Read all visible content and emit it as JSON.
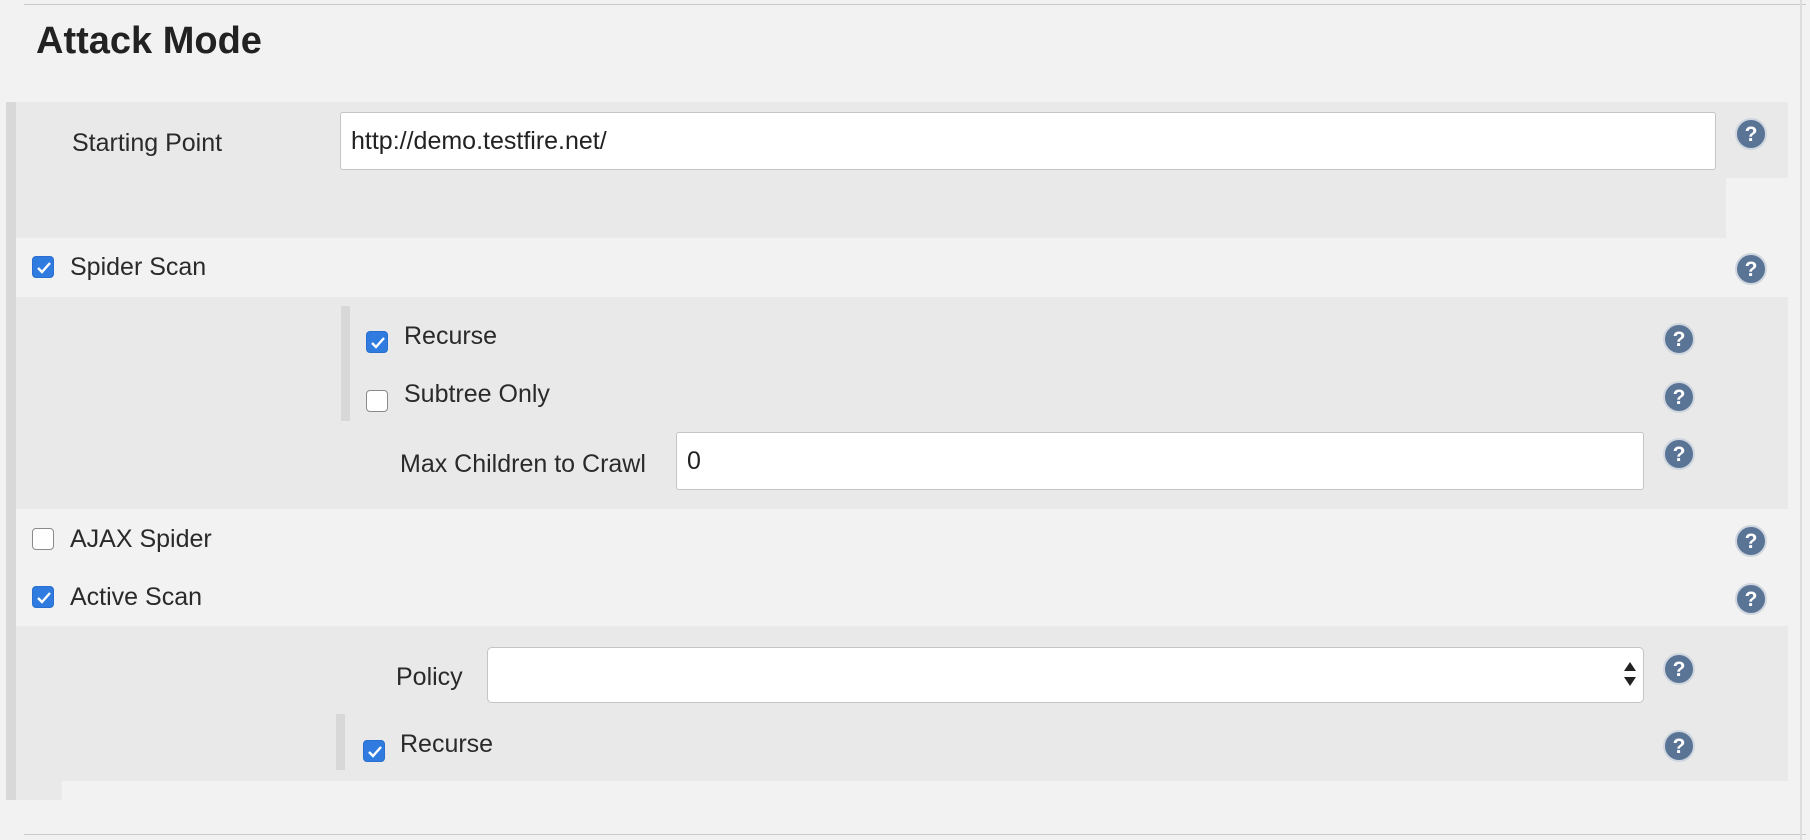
{
  "section": {
    "title": "Attack Mode"
  },
  "starting_point": {
    "label": "Starting Point",
    "value": "http://demo.testfire.net/"
  },
  "spider_scan": {
    "label": "Spider Scan",
    "checked": true,
    "recurse": {
      "label": "Recurse",
      "checked": true
    },
    "subtree_only": {
      "label": "Subtree Only",
      "checked": false
    },
    "max_children": {
      "label": "Max Children to Crawl",
      "value": "0"
    }
  },
  "ajax_spider": {
    "label": "AJAX Spider",
    "checked": false
  },
  "active_scan": {
    "label": "Active Scan",
    "checked": true,
    "policy": {
      "label": "Policy",
      "value": ""
    },
    "recurse": {
      "label": "Recurse",
      "checked": true
    }
  },
  "icons": {
    "help": "help-question-icon",
    "check": "checkmark-icon",
    "select_arrows": "updown-arrows-icon"
  },
  "colors": {
    "checkbox_on": "#2f7be0",
    "help_icon": "#4f6a8c",
    "band": "#e9e9e9"
  }
}
